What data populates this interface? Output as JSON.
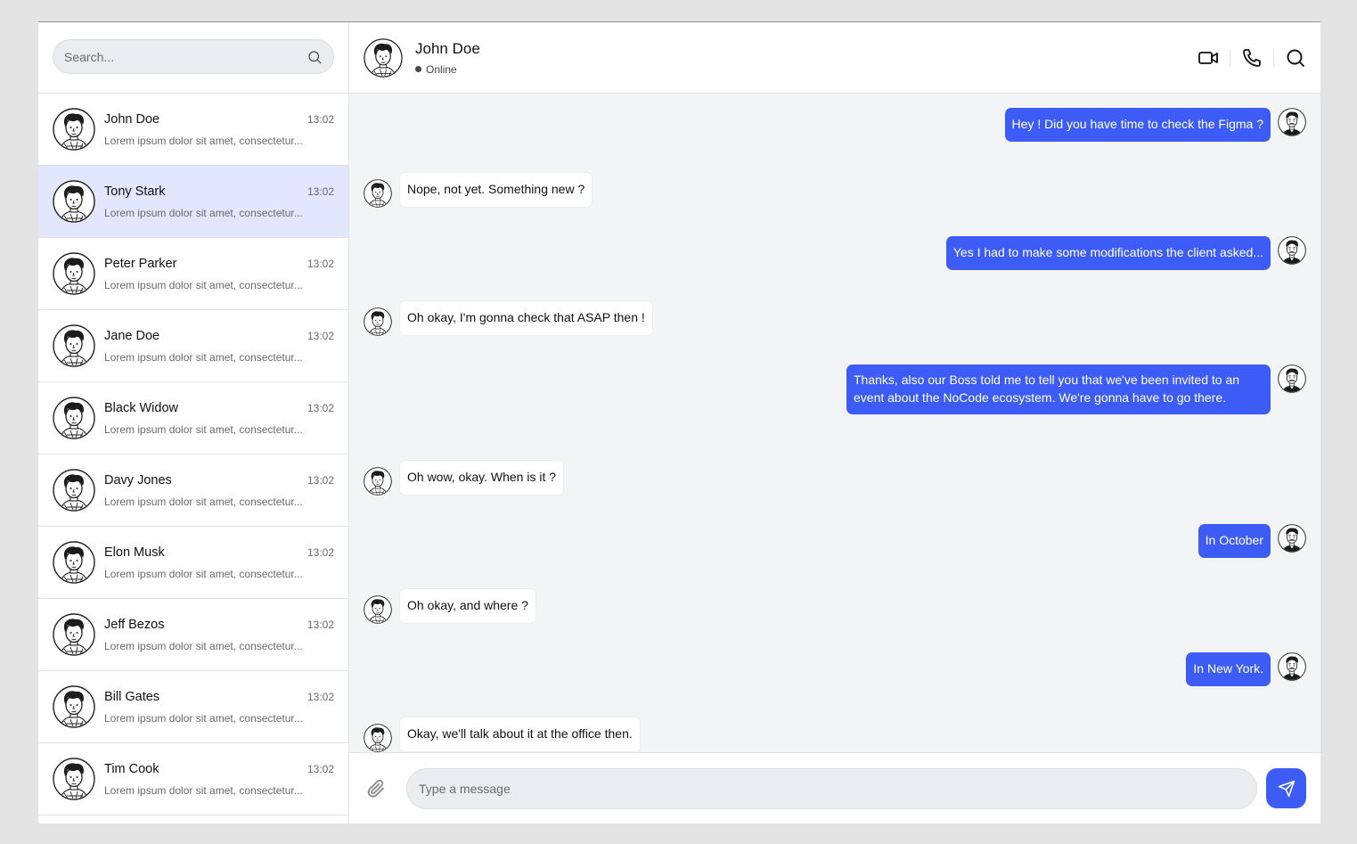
{
  "search": {
    "placeholder": "Search..."
  },
  "conversations": [
    {
      "name": "John Doe",
      "time": "13:02",
      "preview": "Lorem ipsum dolor sit amet, consectetur...",
      "active": false
    },
    {
      "name": "Tony Stark",
      "time": "13:02",
      "preview": "Lorem ipsum dolor sit amet, consectetur...",
      "active": true
    },
    {
      "name": "Peter Parker",
      "time": "13:02",
      "preview": "Lorem ipsum dolor sit amet, consectetur...",
      "active": false
    },
    {
      "name": "Jane Doe",
      "time": "13:02",
      "preview": "Lorem ipsum dolor sit amet, consectetur...",
      "active": false
    },
    {
      "name": "Black Widow",
      "time": "13:02",
      "preview": "Lorem ipsum dolor sit amet, consectetur...",
      "active": false
    },
    {
      "name": "Davy Jones",
      "time": "13:02",
      "preview": "Lorem ipsum dolor sit amet, consectetur...",
      "active": false
    },
    {
      "name": "Elon Musk",
      "time": "13:02",
      "preview": "Lorem ipsum dolor sit amet, consectetur...",
      "active": false
    },
    {
      "name": "Jeff Bezos",
      "time": "13:02",
      "preview": "Lorem ipsum dolor sit amet, consectetur...",
      "active": false
    },
    {
      "name": "Bill Gates",
      "time": "13:02",
      "preview": "Lorem ipsum dolor sit amet, consectetur...",
      "active": false
    },
    {
      "name": "Tim Cook",
      "time": "13:02",
      "preview": "Lorem ipsum dolor sit amet, consectetur...",
      "active": false
    }
  ],
  "chat": {
    "contact_name": "John Doe",
    "status": "Online",
    "actions": [
      "video-icon",
      "phone-icon",
      "search-icon"
    ]
  },
  "messages": [
    {
      "direction": "out",
      "text": "Hey ! Did you have time to check the Figma ?"
    },
    {
      "direction": "in",
      "text": "Nope, not yet. Something new ?"
    },
    {
      "direction": "out",
      "text": "Yes I had to make some modifications the client asked..."
    },
    {
      "direction": "in",
      "text": "Oh okay, I'm gonna check that ASAP then !"
    },
    {
      "direction": "out",
      "text": "Thanks, also our Boss told me to tell you that we've been invited to an event about the NoCode ecosystem. We're gonna have to go there."
    },
    {
      "direction": "in",
      "text": "Oh wow, okay. When is it ?"
    },
    {
      "direction": "out",
      "text": "In October"
    },
    {
      "direction": "in",
      "text": "Oh okay, and where ?"
    },
    {
      "direction": "out",
      "text": "In New York."
    },
    {
      "direction": "in",
      "text": "Okay, we'll talk about it at the office then."
    }
  ],
  "composer": {
    "placeholder": "Type a message"
  },
  "colors": {
    "accent": "#3d5cf5",
    "active_row": "#e3e7fd",
    "chat_bg": "#f3f4f6"
  }
}
